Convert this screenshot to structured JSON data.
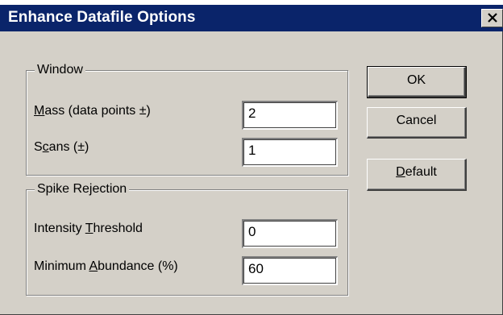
{
  "dialog": {
    "title": "Enhance Datafile Options",
    "close_glyph": "✕"
  },
  "window_group": {
    "legend": "Window",
    "mass": {
      "label_pre": "",
      "label_accel": "M",
      "label_post": "ass (data points ±)",
      "value": "2"
    },
    "scans": {
      "label_pre": "S",
      "label_accel": "c",
      "label_post": "ans (±)",
      "value": "1"
    }
  },
  "spike_group": {
    "legend": "Spike Rejection",
    "intensity": {
      "label_pre": "Intensity ",
      "label_accel": "T",
      "label_post": "hreshold",
      "value": "0"
    },
    "abundance": {
      "label_pre": "Minimum ",
      "label_accel": "A",
      "label_post": "bundance (%)",
      "value": "60"
    }
  },
  "buttons": {
    "ok": {
      "label": "OK"
    },
    "cancel": {
      "label": "Cancel"
    },
    "default": {
      "label_accel": "D",
      "label_post": "efault"
    }
  },
  "colors": {
    "titlebar": "#0a246a",
    "face": "#d4d0c8"
  }
}
